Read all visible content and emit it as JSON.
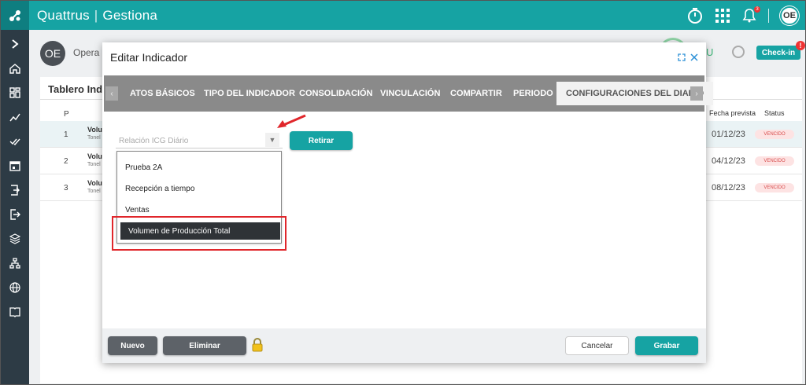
{
  "app": {
    "brand": "Quattrus",
    "product": "Gestiona",
    "user_initials": "OE",
    "notification_count": "3"
  },
  "background": {
    "user_initials": "OE",
    "user_name": "Opera",
    "status_letter": "U",
    "checkin_label": "Check-in",
    "checkin_badge": "!",
    "panel_title": "Tablero Indica",
    "col_p": "P",
    "col_fecha": "Fecha prevista",
    "col_status": "Status",
    "rows": [
      {
        "num": "1",
        "name": "Volu",
        "sub": "Tonel",
        "date": "01/12/23",
        "status": "VENCIDO"
      },
      {
        "num": "2",
        "name": "Volu",
        "sub": "Tonel",
        "date": "04/12/23",
        "status": "VENCIDO"
      },
      {
        "num": "3",
        "name": "Volu",
        "sub": "Tonel",
        "date": "08/12/23",
        "status": "VENCIDO"
      }
    ]
  },
  "modal": {
    "title": "Editar Indicador",
    "tabs": [
      {
        "label": "ATOS BÁSICOS"
      },
      {
        "label": "TIPO DEL INDICADOR"
      },
      {
        "label": "CONSOLIDACIÓN"
      },
      {
        "label": "VINCULACIÓN"
      },
      {
        "label": "COMPARTIR"
      },
      {
        "label": "PERIODO"
      },
      {
        "label": "CONFIGURACIONES DEL DIARIO",
        "active": true
      }
    ],
    "select_placeholder": "Relación ICG Diário",
    "retirar_label": "Retirar",
    "dropdown_options": [
      {
        "label": "Prueba 2A"
      },
      {
        "label": "Recepción a tiempo"
      },
      {
        "label": "Ventas"
      },
      {
        "label": "Volumen de Producción Total",
        "selected": true
      }
    ],
    "footer": {
      "nuevo": "Nuevo",
      "eliminar": "Eliminar",
      "cancelar": "Cancelar",
      "grabar": "Grabar"
    }
  },
  "colors": {
    "accent": "#16a3a3",
    "sidebar": "#2d3b45",
    "highlight": "#e0262b",
    "tab_bar": "#8a8a8a"
  },
  "icons": [
    "logo-icon",
    "timer-icon",
    "apps-grid-icon",
    "bell-icon",
    "chevron-right-icon",
    "home-icon",
    "dashboard-icon",
    "trend-icon",
    "check-double-icon",
    "calendar-icon",
    "login-icon",
    "logout-icon",
    "layers-icon",
    "org-chart-icon",
    "globe-icon",
    "book-icon",
    "expand-icon",
    "close-icon",
    "caret-down-icon",
    "lock-icon",
    "arrow-annotation-icon"
  ]
}
